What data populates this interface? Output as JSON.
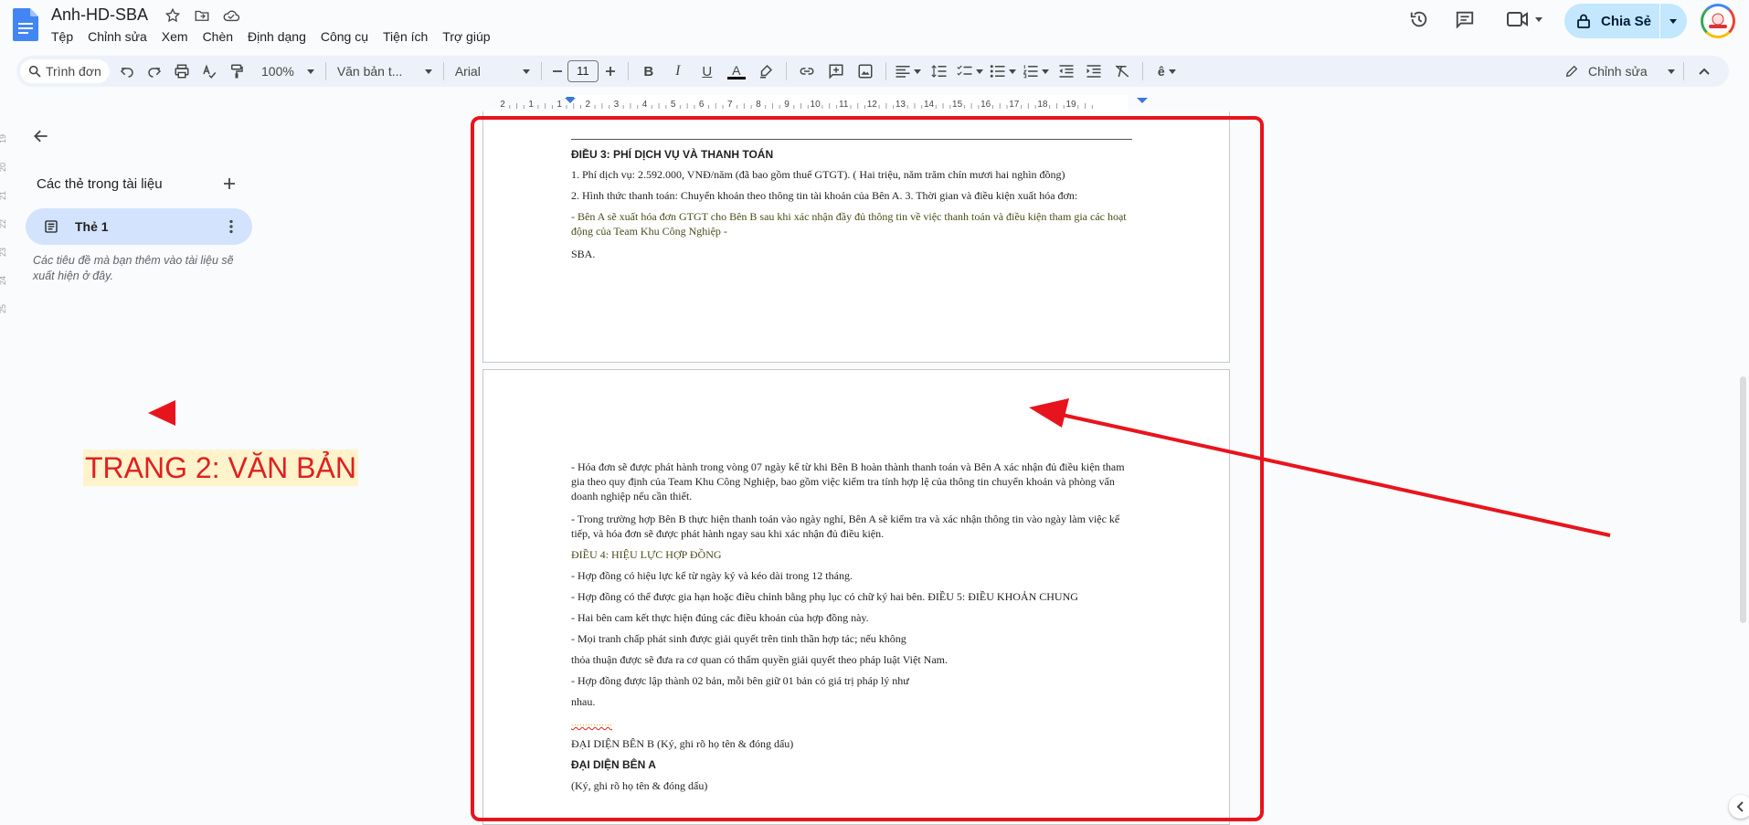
{
  "app": {
    "doc_title": "Anh-HD-SBA",
    "menu": [
      "Tệp",
      "Chỉnh sửa",
      "Xem",
      "Chèn",
      "Định dạng",
      "Công cụ",
      "Tiện ích",
      "Trợ giúp"
    ],
    "share_label": "Chia Sẻ",
    "accent": "#c2e7ff"
  },
  "toolbar": {
    "search_placeholder": "Trình đơn",
    "zoom": "100%",
    "style": "Văn bản t...",
    "font": "Arial",
    "font_size": "11",
    "mode": "Chỉnh sửa"
  },
  "ruler": {
    "ticks": [
      "2",
      "1",
      "1",
      "2",
      "3",
      "4",
      "5",
      "6",
      "7",
      "8",
      "9",
      "10",
      "11",
      "12",
      "13",
      "14",
      "15",
      "16",
      "17",
      "18",
      "19"
    ]
  },
  "left_ruler": [
    "19",
    "20",
    "21",
    "22",
    "23",
    "24",
    "25"
  ],
  "sidebar": {
    "heading": "Các thẻ trong tài liệu",
    "tab_label": "Thẻ 1",
    "hint": "Các tiêu đề mà bạn thêm vào tài liệu sẽ xuất hiện ở đây."
  },
  "annotation": {
    "label": "TRANG 2: VĂN BẢN",
    "color": "#e8141d"
  },
  "page1": {
    "lines": [
      {
        "text": "ĐIỀU 3: PHÍ DỊCH VỤ VÀ THANH TOÁN",
        "style": "bold"
      },
      {
        "text": "1. Phí dịch vụ: 2.592.000, VNĐ/năm (đã bao gồm thuế GTGT). ( Hai triệu, năm trăm chín mươi hai nghìn đồng)",
        "style": "normal"
      },
      {
        "text": "2. Hình thức thanh toán: Chuyển khoản theo thông tin tài khoản của Bên A. 3. Thời gian và điều kiện xuất hóa đơn:",
        "style": "normal"
      },
      {
        "text": "- Bên A sẽ xuất hóa đơn GTGT cho Bên B sau khi xác nhận đầy đủ thông tin về việc thanh toán và điều kiện tham gia các hoạt động của Team Khu Công Nghiệp -",
        "style": "olive"
      },
      {
        "text": "SBA.",
        "style": "normal"
      }
    ]
  },
  "page2": {
    "lines": [
      {
        "text": "- Hóa đơn sẽ được phát hành trong vòng 07 ngày kể từ khi Bên B hoàn thành thanh toán và Bên A xác nhận đủ điều kiện tham gia theo quy định của Team Khu Công Nghiệp, bao gồm việc kiểm tra tính hợp lệ của thông tin chuyển khoản và phòng vấn doanh nghiệp nếu cần thiết.",
        "style": "normal"
      },
      {
        "text": "- Trong trường hợp Bên B thực hiện thanh toán vào ngày nghỉ, Bên A sẽ kiểm tra và xác nhận thông tin vào ngày làm việc kế tiếp, và hóa đơn sẽ được phát hành ngay sau khi xác nhận đủ điều kiện.",
        "style": "normal"
      },
      {
        "text": "ĐIỀU 4: HIỆU LỰC HỢP ĐỒNG",
        "style": "olive"
      },
      {
        "text": "- Hợp đồng có hiệu lực kể từ ngày ký và kéo dài trong 12 tháng.",
        "style": "normal"
      },
      {
        "text": "- Hợp đồng có thể được gia hạn hoặc điều chỉnh bằng phụ lục có chữ ký hai bên. ĐIỀU 5: ĐIỀU KHOẢN CHUNG",
        "style": "normal"
      },
      {
        "text": "- Hai bên cam kết thực hiện đúng các điều khoản của hợp đồng này.",
        "style": "normal"
      },
      {
        "text": "- Mọi tranh chấp phát sinh được giải quyết trên tinh thần hợp tác; nếu không",
        "style": "normal"
      },
      {
        "text": "thỏa thuận được sẽ đưa ra cơ quan có thẩm quyền giải quyết theo pháp luật Việt Nam.",
        "style": "normal"
      },
      {
        "text": "- Hợp đồng được lập thành 02 bản, mỗi bên giữ 01 bản có giá trị pháp lý như",
        "style": "normal"
      },
      {
        "text": "nhau.",
        "style": "normal"
      },
      {
        "text": "……………",
        "style": "squiggle"
      },
      {
        "text": "ĐẠI DIỆN BÊN B (Ký, ghi rõ họ tên & đóng dấu)",
        "style": "normal"
      },
      {
        "text": "ĐẠI DIỆN BÊN A",
        "style": "bold"
      },
      {
        "text": "(Ký, ghi rõ họ tên & đóng dấu)",
        "style": "normal"
      }
    ]
  }
}
